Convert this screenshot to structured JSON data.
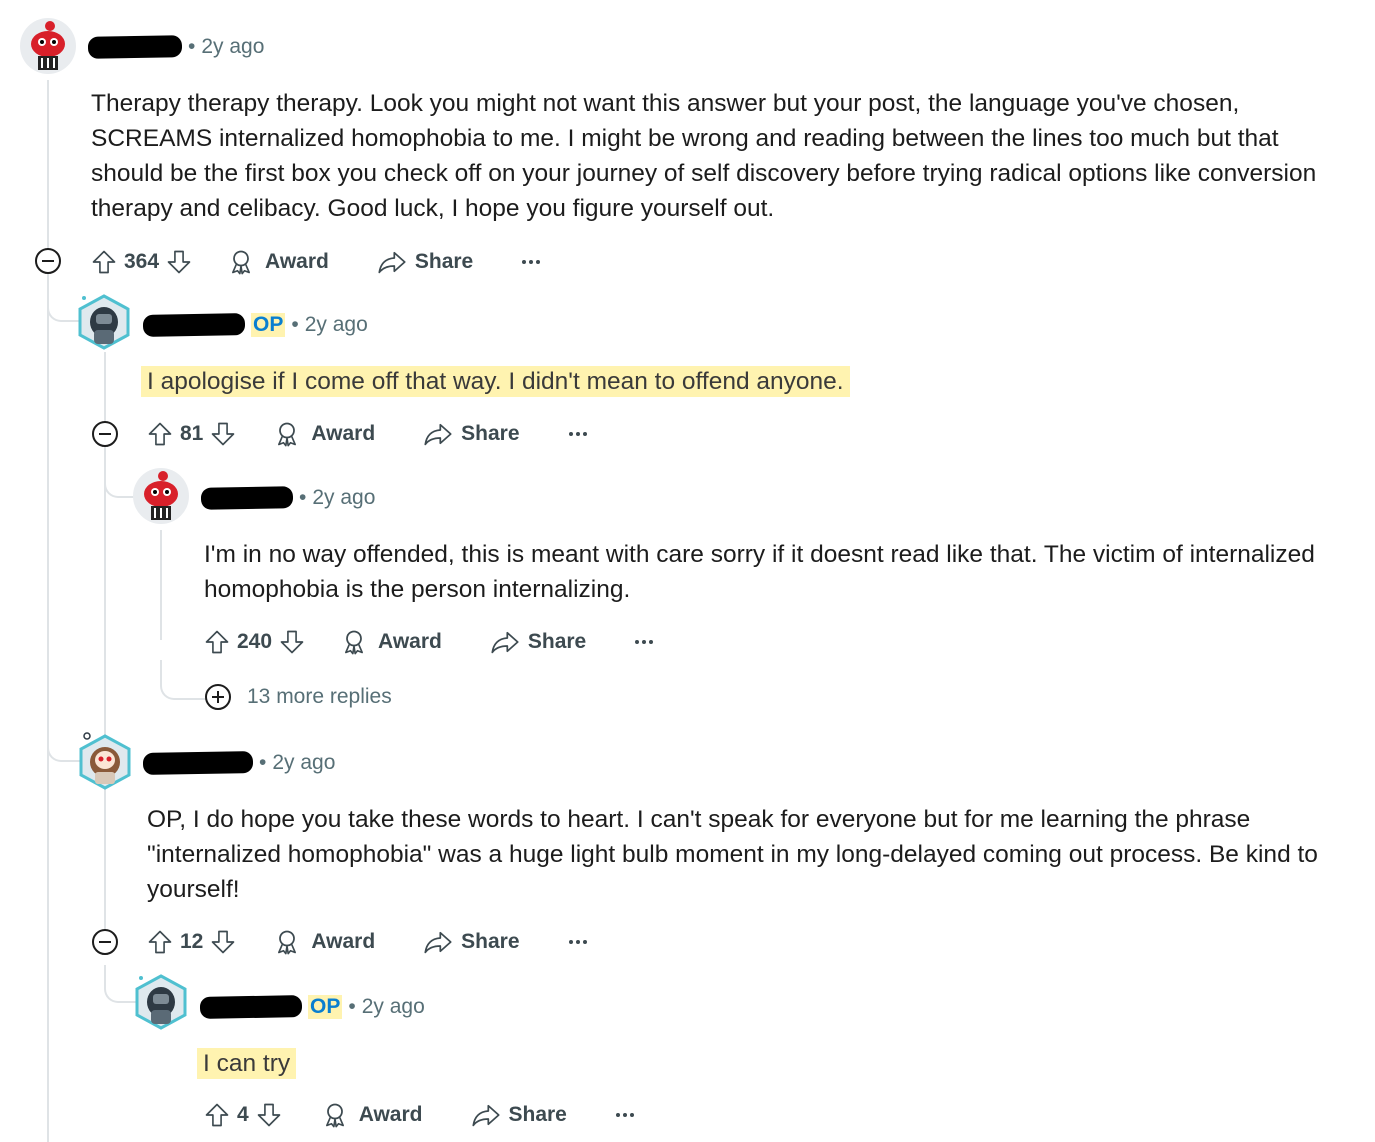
{
  "comments": [
    {
      "time": "2y ago",
      "body": "Therapy therapy therapy. Look you might not want this answer but your post, the language you've chosen, SCREAMS internalized homophobia to me. I might be wrong and reading between the lines too much but that should be the first box you check off on your journey of self discovery before trying radical options like conversion therapy and celibacy. Good luck, I hope you figure yourself out.",
      "votes": "364",
      "award": "Award",
      "share": "Share"
    },
    {
      "op": "OP",
      "time": "2y ago",
      "body": "I apologise if I come off that way. I didn't mean to offend anyone.",
      "votes": "81",
      "award": "Award",
      "share": "Share"
    },
    {
      "time": "2y ago",
      "body": "I'm in no way offended, this is meant with care sorry if it doesnt read like that. The victim of internalized homophobia is the person internalizing.",
      "votes": "240",
      "award": "Award",
      "share": "Share",
      "more_replies": "13 more replies"
    },
    {
      "time": "2y ago",
      "body": "OP, I do hope you take these words to heart. I can't speak for everyone but for me learning the phrase \"internalized homophobia\" was a huge light bulb moment in my long-delayed coming out process. Be kind to yourself!",
      "votes": "12",
      "award": "Award",
      "share": "Share"
    },
    {
      "op": "OP",
      "time": "2y ago",
      "body": "I can try",
      "votes": "4",
      "award": "Award",
      "share": "Share"
    }
  ],
  "separator": "•",
  "icons": [
    "upvote-icon",
    "downvote-icon",
    "award-icon",
    "share-icon",
    "more-icon",
    "collapse-icon",
    "expand-icon"
  ],
  "colors": {
    "highlight": "#fff3b0",
    "op": "#0a7fd0",
    "thread": "#dfe3e6",
    "meta": "#576f76"
  }
}
